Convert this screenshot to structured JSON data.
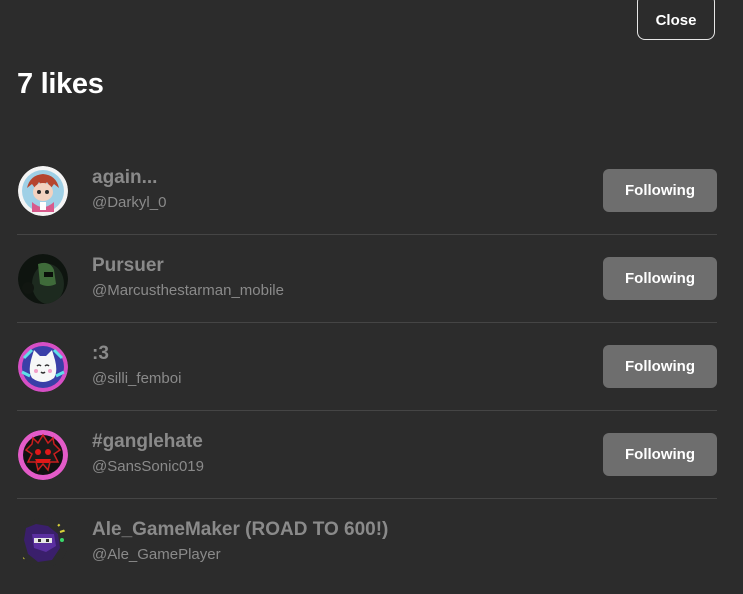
{
  "header": {
    "close_label": "Close",
    "title": "7 likes"
  },
  "users": [
    {
      "display_name": "again...",
      "username": "@Darkyl_0",
      "button_label": "Following",
      "avatar_icon": "red-haired-character-avatar"
    },
    {
      "display_name": "Pursuer",
      "username": "@Marcusthestarman_mobile",
      "button_label": "Following",
      "avatar_icon": "dark-green-figure-avatar"
    },
    {
      "display_name": ":3",
      "username": "@silli_femboi",
      "button_label": "Following",
      "avatar_icon": "white-cat-avatar"
    },
    {
      "display_name": "#ganglehate",
      "username": "@SansSonic019",
      "button_label": "Following",
      "avatar_icon": "black-red-spiky-avatar"
    },
    {
      "display_name": "Ale_GameMaker (ROAD TO 600!)",
      "username": "@Ale_GamePlayer",
      "avatar_icon": "purple-ninja-avatar"
    }
  ],
  "colors": {
    "background": "#2c2c2c",
    "text_muted": "#8a8a8a",
    "button_bg": "#6e6e6e",
    "divider": "#454545"
  }
}
